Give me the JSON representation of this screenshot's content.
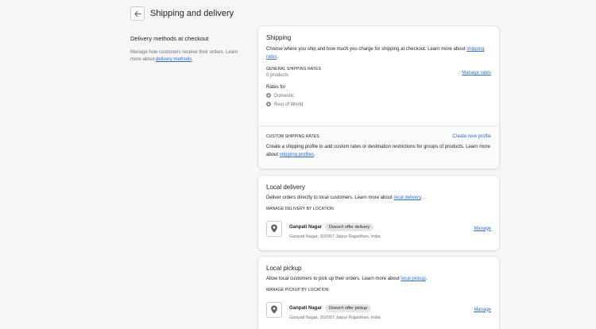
{
  "header": {
    "title": "Shipping and delivery"
  },
  "aside": {
    "title": "Delivery methods at checkout",
    "desc_pre": "Manage how customers receive their orders. Learn more about ",
    "desc_link": "delivery methods",
    "desc_post": "."
  },
  "shipping": {
    "title": "Shipping",
    "desc_pre": "Choose where you ship and how much you charge for shipping at checkout. Learn more about ",
    "desc_link": "shipping rates",
    "desc_post": ".",
    "general_heading": "GENERAL SHIPPING RATES",
    "products": "0 products",
    "manage_rates": "Manage rates",
    "rates_for": "Rates for",
    "zones": [
      "Domestic",
      "Rest of World"
    ],
    "custom_heading": "CUSTOM SHIPPING RATES",
    "create_profile": "Create new profile",
    "custom_desc_pre": "Create a shipping profile to add custom rates or destination restrictions for groups of products. Learn more about ",
    "custom_desc_link": "shipping profiles",
    "custom_desc_post": "."
  },
  "local_delivery": {
    "title": "Local delivery",
    "desc_pre": "Deliver orders directly to local customers. Learn more about ",
    "desc_link": "local delivery",
    "desc_post": ".",
    "heading": "MANAGE DELIVERY BY LOCATION",
    "location": {
      "name": "Ganpati Nagar",
      "badge": "Doesn't offer delivery",
      "address": "Ganpati Nagar, 302007 Jaipur Rajasthan, India",
      "manage": "Manage"
    }
  },
  "local_pickup": {
    "title": "Local pickup",
    "desc_pre": "Allow local customers to pick up their orders. Learn more about ",
    "desc_link": "local pickup",
    "desc_post": ".",
    "heading": "MANAGE PICKUP BY LOCATION",
    "location": {
      "name": "Ganpati Nagar",
      "badge": "Doesn't offer pickup",
      "address": "Ganpati Nagar, 302007 Jaipur Rajasthan, India",
      "manage": "Manage"
    }
  }
}
